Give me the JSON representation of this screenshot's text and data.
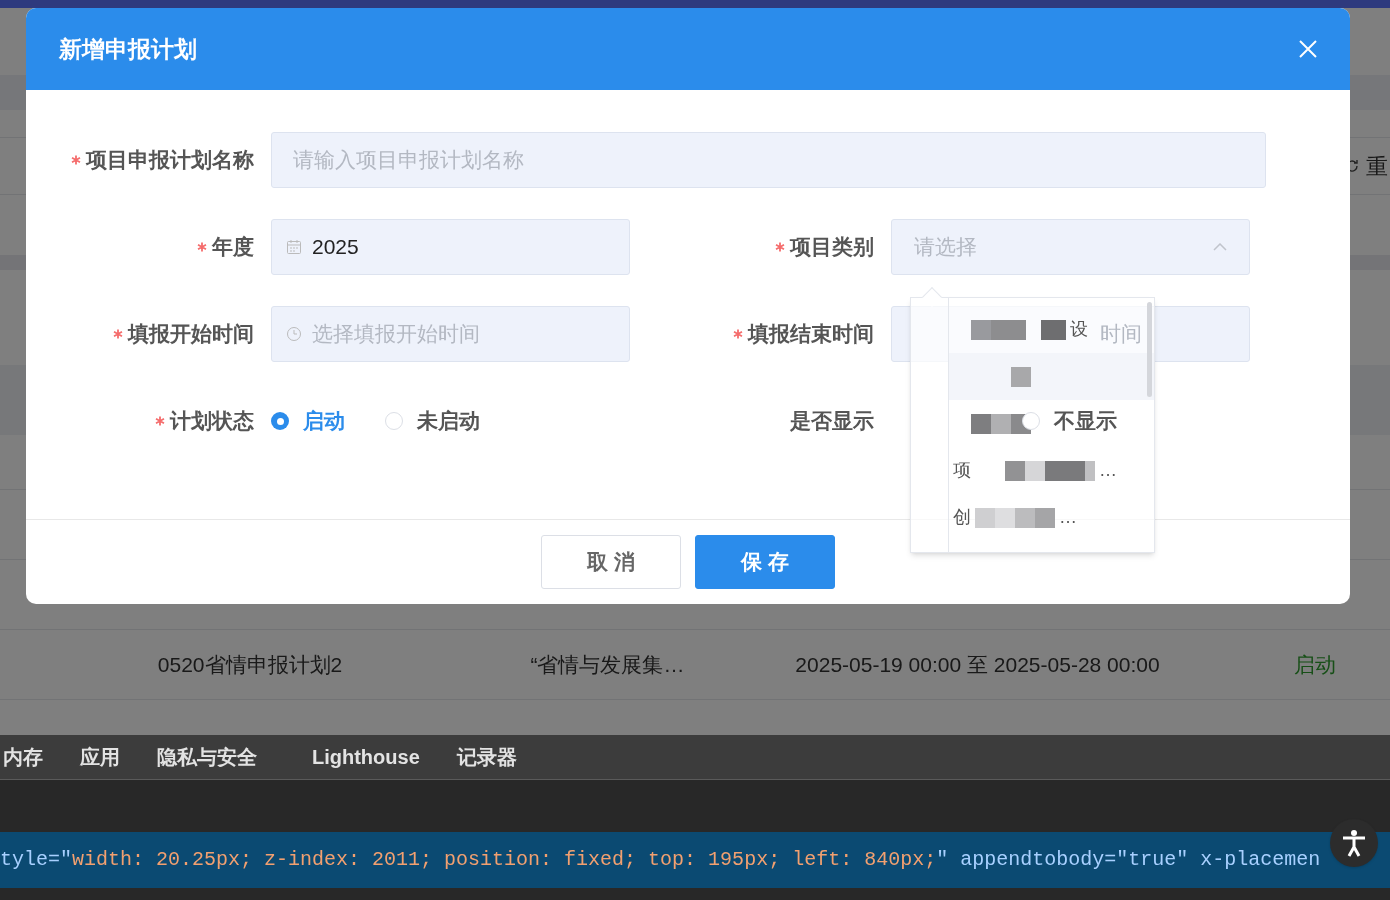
{
  "page": {
    "reset_button": "重",
    "table_row": [
      "0520省情申报计划2",
      "“省情与发展集…",
      "2025-05-19 00:00 至 2025-05-28 00:00",
      "启动"
    ]
  },
  "dialog": {
    "title": "新增申报计划",
    "fields": [
      {
        "kind": "text",
        "label": "项目申报计划名称",
        "required": true,
        "placeholder": "请输入项目申报计划名称"
      },
      {
        "kind": "date",
        "label": "年度",
        "required": true,
        "value": "2025"
      },
      {
        "kind": "select",
        "label": "项目类别",
        "required": true,
        "placeholder": "请选择",
        "expanded": true
      },
      {
        "kind": "time",
        "label": "填报开始时间",
        "required": true,
        "placeholder": "选择填报开始时间"
      },
      {
        "kind": "covered",
        "label": "填报结束时间",
        "required": true,
        "placeholder": "时间"
      },
      {
        "kind": "radio",
        "label": "计划状态",
        "required": true,
        "options": [
          {
            "label": "启动",
            "selected": true
          },
          {
            "label": "未启动",
            "selected": false
          }
        ]
      },
      {
        "kind": "radio",
        "label": "是否显示",
        "required": false,
        "options": [
          {
            "label": "不显示",
            "selected": false
          }
        ]
      }
    ],
    "buttons": [
      {
        "label": "取 消",
        "kind": "secondary"
      },
      {
        "label": "保 存",
        "kind": "primary"
      }
    ]
  },
  "dropdown": {
    "items": [
      {
        "highlighted": false,
        "tail": "设"
      },
      {
        "highlighted": true
      },
      {
        "highlighted": false
      },
      {
        "highlighted": false,
        "head": "项",
        "tail": "…"
      },
      {
        "highlighted": false,
        "head": "创",
        "tail": "…"
      }
    ]
  },
  "devtools": {
    "tabs": [
      "内存",
      "应用",
      "隐私与安全",
      "Lighthouse",
      "记录器"
    ],
    "code_line": [
      {
        "kind": "attr",
        "text": "tyle=\""
      },
      {
        "kind": "value",
        "text": "width: 20.25px; z-index: 2011; position: fixed; top: 195px; left: 840px;"
      },
      {
        "kind": "attr",
        "text": "\" appendtobody=\"true\" x-placemen"
      }
    ]
  }
}
